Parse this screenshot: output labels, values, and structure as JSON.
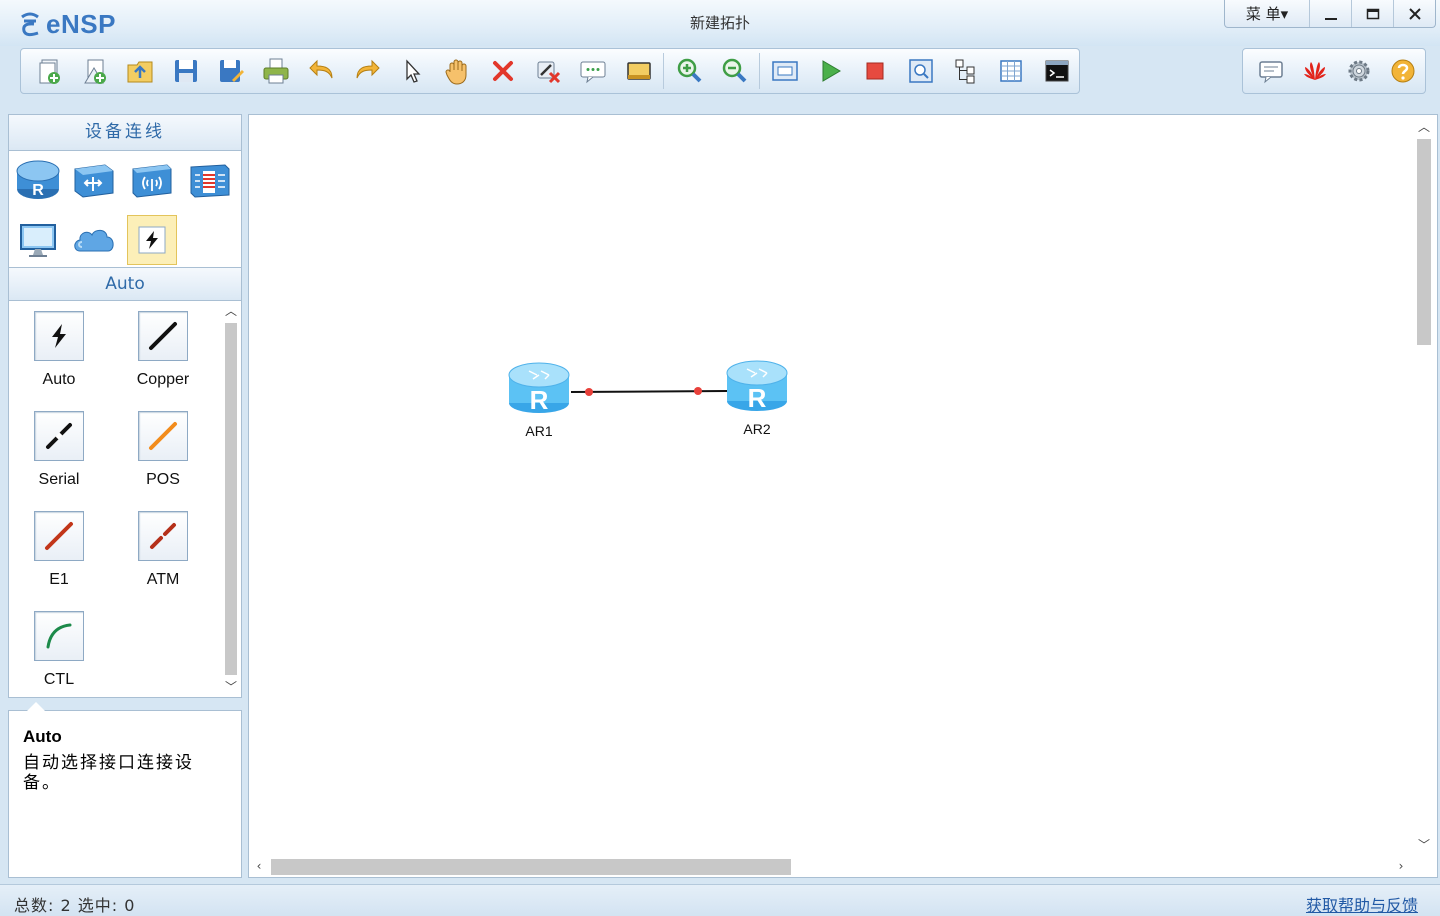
{
  "app": {
    "logo_text": "eNSP",
    "window_title": "新建拓扑",
    "menu_label": "菜 单▾",
    "minimize_glyph": "—",
    "maximize_glyph": "▭",
    "close_glyph": "✕"
  },
  "toolbar": {
    "buttons": [
      "new-topology",
      "new-from-template",
      "open",
      "save",
      "save-as",
      "print",
      "undo",
      "redo",
      "select",
      "pan",
      "delete",
      "delete-all-links",
      "text",
      "palette",
      "zoom-in",
      "zoom-out",
      "fit-to-screen",
      "start-devices",
      "stop-devices",
      "capture",
      "show-interfaces",
      "grid",
      "command-line"
    ],
    "right_buttons": [
      "forum",
      "huawei",
      "settings",
      "help"
    ]
  },
  "left_panel": {
    "title": "设备连线",
    "categories": [
      "router",
      "switch",
      "wireless",
      "firewall",
      "pc",
      "cloud",
      "cable"
    ],
    "selected_category": "cable",
    "subtitle": "Auto",
    "cables": [
      {
        "label": "Auto",
        "icon": "auto-lightning-icon"
      },
      {
        "label": "Copper",
        "icon": "copper-icon",
        "color": "#111111"
      },
      {
        "label": "Serial",
        "icon": "serial-icon",
        "color": "#111111"
      },
      {
        "label": "POS",
        "icon": "pos-icon",
        "color": "#f28c1c"
      },
      {
        "label": "E1",
        "icon": "e1-icon",
        "color": "#c2361a"
      },
      {
        "label": "ATM",
        "icon": "atm-icon",
        "color": "#b5301a"
      },
      {
        "label": "CTL",
        "icon": "ctl-icon",
        "color": "#1c8a4a"
      }
    ]
  },
  "description": {
    "title": "Auto",
    "text": "自动选择接口连接设备。"
  },
  "canvas": {
    "nodes": [
      {
        "name": "AR1",
        "type": "router"
      },
      {
        "name": "AR2",
        "type": "router"
      }
    ],
    "link_color": "#111111",
    "port_dot_color": "#e8403a"
  },
  "status": {
    "left": "总数: 2 选中: 0",
    "right": "获取帮助与反馈"
  }
}
